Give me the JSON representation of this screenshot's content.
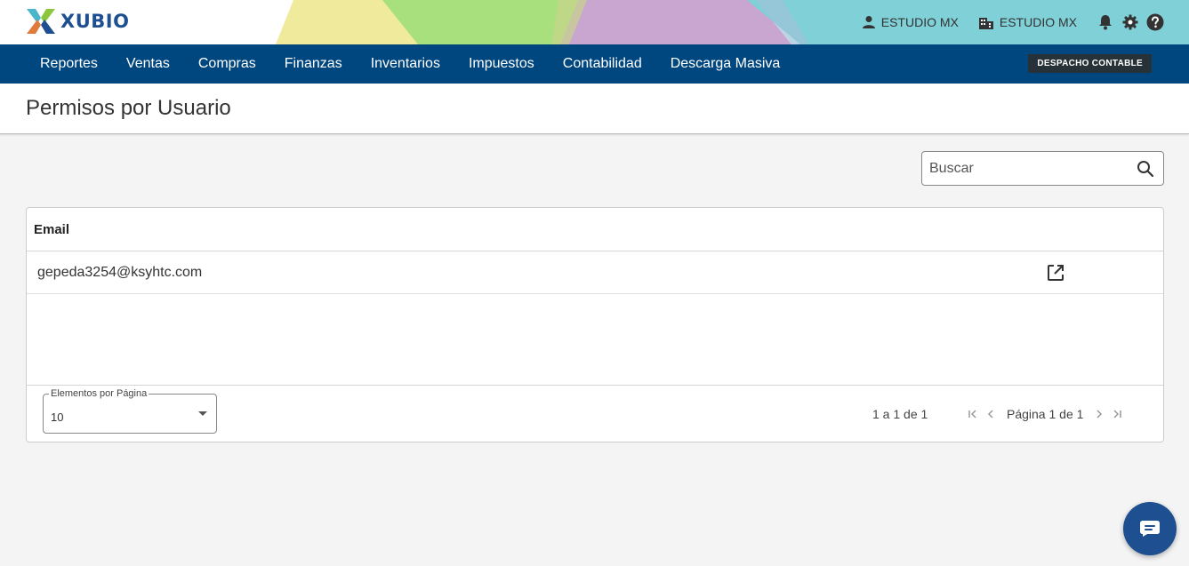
{
  "brand": {
    "name": "XUBIO"
  },
  "header": {
    "user_label": "ESTUDIO MX",
    "company_label": "ESTUDIO MX",
    "icons": [
      "person-icon",
      "building-icon",
      "bell-icon",
      "gear-icon",
      "help-icon"
    ]
  },
  "nav": {
    "items": [
      {
        "label": "Reportes"
      },
      {
        "label": "Ventas"
      },
      {
        "label": "Compras"
      },
      {
        "label": "Finanzas"
      },
      {
        "label": "Inventarios"
      },
      {
        "label": "Impuestos"
      },
      {
        "label": "Contabilidad"
      },
      {
        "label": "Descarga Masiva"
      }
    ],
    "badge": "DESPACHO CONTABLE"
  },
  "page": {
    "title": "Permisos por Usuario"
  },
  "search": {
    "placeholder": "Buscar",
    "value": ""
  },
  "table": {
    "columns": [
      "Email"
    ],
    "rows": [
      {
        "email": "gepeda3254@ksyhtc.com"
      }
    ]
  },
  "pagination": {
    "page_size_label": "Elementos por Página",
    "page_size_value": "10",
    "range_text": "1 a 1 de 1",
    "page_text": "Página 1 de 1"
  },
  "colors": {
    "nav_bg": "#00467f",
    "brand_blue": "#1d4f91",
    "badge_bg": "#263238",
    "header_yellow": "#f0e9a3",
    "header_green": "#a8e07c",
    "header_purple": "#c9a6cf",
    "header_teal": "#7fd0d6"
  }
}
